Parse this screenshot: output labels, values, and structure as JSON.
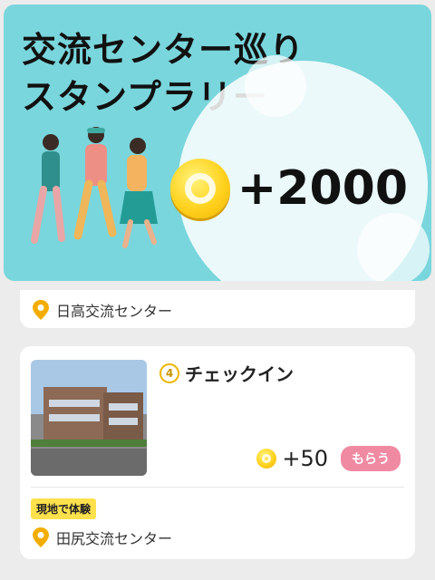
{
  "banner": {
    "title_line1": "交流センター巡り",
    "title_line2": "スタンプラリー",
    "reward": "+2000",
    "coin_icon": "coin-icon"
  },
  "previous_card": {
    "location": "日高交流センター"
  },
  "card": {
    "step_number": "4",
    "title": "チェックイン",
    "points": "+50",
    "get_button": "もらう",
    "tag": "現地で体験",
    "location": "田尻交流センター"
  },
  "colors": {
    "banner_bg": "#79d6dc",
    "coin": "#ffd21f",
    "get_button": "#f08aa2",
    "tag": "#ffe14d",
    "pin": "#f3ad00"
  }
}
